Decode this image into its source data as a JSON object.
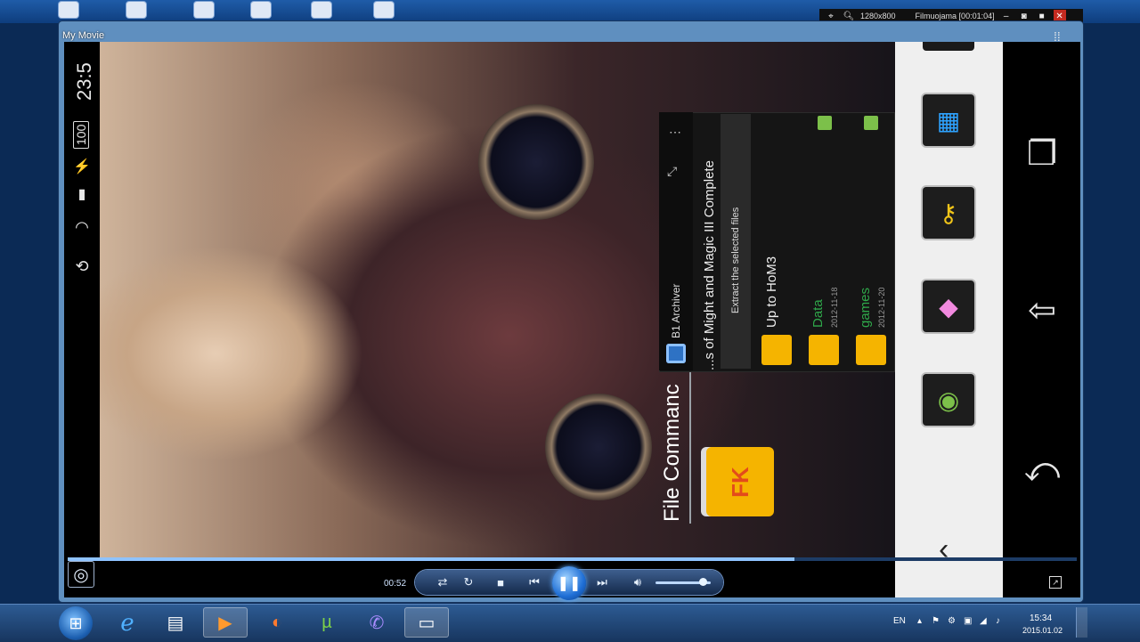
{
  "player": {
    "window_title": "My Movie",
    "elapsed_time": "00:52",
    "progress": 0.72,
    "volume": 0.85
  },
  "recorder": {
    "resolution": "1280x800",
    "recording_label": "Filmuojama [00:01:04]"
  },
  "android": {
    "status": {
      "clock": "23:5",
      "battery": "100"
    },
    "file_commander_title": "File Commanc",
    "archiver": {
      "app_name": "B1 Archiver",
      "path": "...s of Might and Magic III Complete",
      "extract_label": "Extract the selected files",
      "up_label": "Up to HoM3",
      "items": [
        {
          "name": "Data",
          "date": "2012-11-18"
        },
        {
          "name": "games",
          "date": "2012-11-20"
        }
      ]
    },
    "fk_logo": "FK"
  },
  "tray": {
    "language": "EN",
    "time": "15:34",
    "date": "2015.01.02"
  },
  "colors": {
    "accent_blue": "#1f6fd6",
    "folder_yellow": "#f5b400",
    "green_text": "#2fa84a"
  }
}
